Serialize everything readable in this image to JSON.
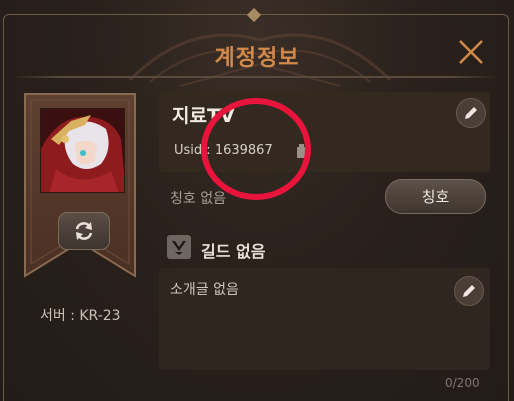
{
  "window": {
    "title": "계정정보"
  },
  "profile": {
    "nickname": "지료TV",
    "uid_label": "Usid",
    "uid_value": "1639867",
    "server_label": "서버 : KR-23"
  },
  "honor": {
    "current": "칭호 없음",
    "button_label": "칭호"
  },
  "guild": {
    "label": "길드 없음"
  },
  "intro": {
    "text": "소개글 없음",
    "counter": "0/200"
  },
  "icons": {
    "close": "close-icon",
    "refresh": "refresh-icon",
    "edit_name": "pencil-icon",
    "edit_intro": "pencil-icon",
    "copy": "copy-icon",
    "guild": "guild-emblem-icon"
  },
  "colors": {
    "title": "#d18a4a",
    "annotation_circle": "#e8143b",
    "banner": "#5a3a2a"
  }
}
